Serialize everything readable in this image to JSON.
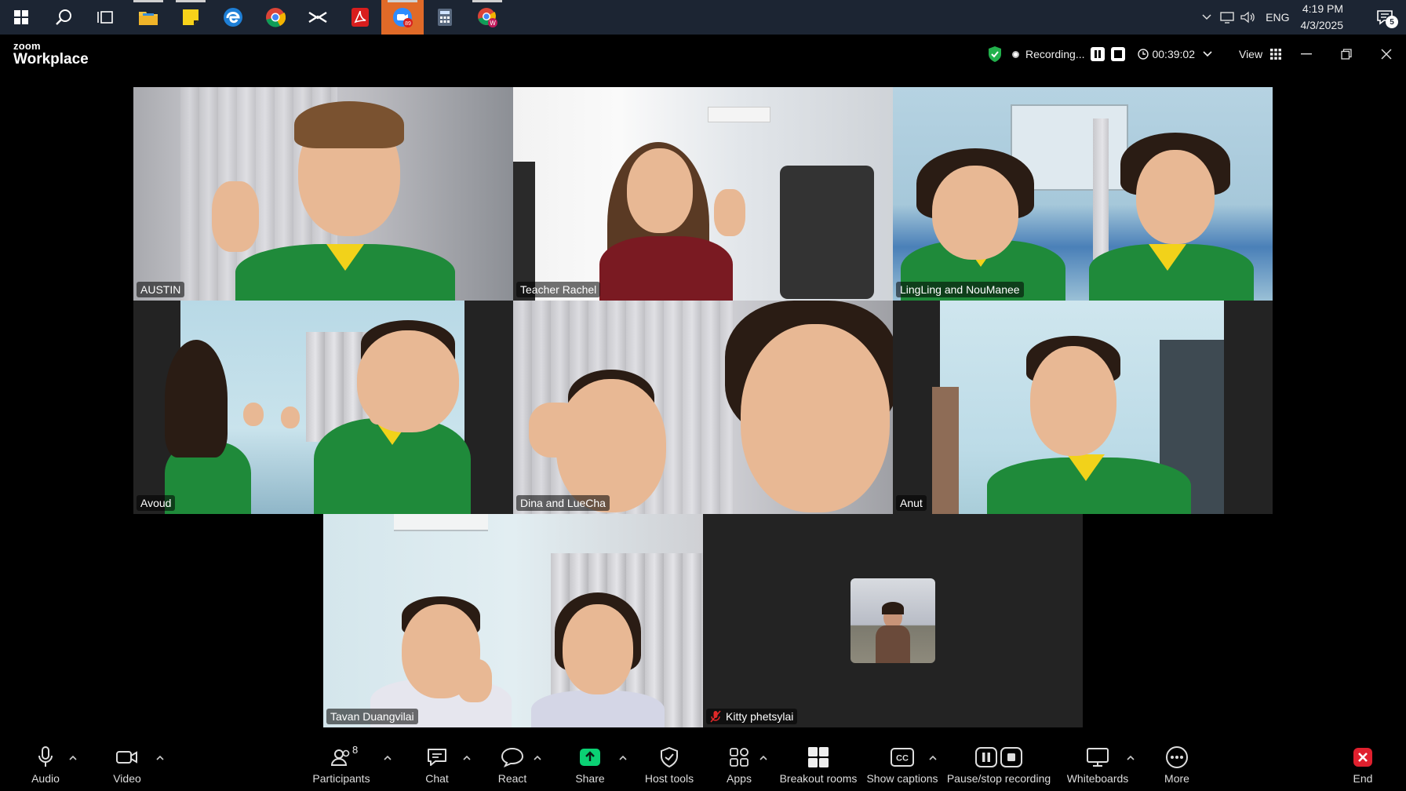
{
  "taskbar": {
    "apps": [
      {
        "name": "start-icon"
      },
      {
        "name": "search-icon"
      },
      {
        "name": "task-view-icon"
      },
      {
        "name": "file-explorer-icon"
      },
      {
        "name": "sticky-notes-icon"
      },
      {
        "name": "edge-icon"
      },
      {
        "name": "chrome-icon"
      },
      {
        "name": "capcut-icon"
      },
      {
        "name": "acrobat-icon"
      },
      {
        "name": "zoom-icon"
      },
      {
        "name": "calculator-icon"
      },
      {
        "name": "chrome-profile-icon"
      }
    ],
    "lang": "ENG",
    "time": "4:19 PM",
    "date": "4/3/2025",
    "notification_count": "5"
  },
  "zoom": {
    "logo_small": "zoom",
    "logo_big": "Workplace",
    "recording_label": "Recording...",
    "timer": "00:39:02",
    "view_label": "View"
  },
  "participants": [
    {
      "name": "AUSTIN"
    },
    {
      "name": "Teacher Rachel"
    },
    {
      "name": "LingLing and NouManee"
    },
    {
      "name": "Avoud"
    },
    {
      "name": "Dina and LueCha"
    },
    {
      "name": "Anut"
    },
    {
      "name": "Tavan Duangvilai"
    },
    {
      "name": "Kitty phetsylai"
    }
  ],
  "toolbar": {
    "audio": "Audio",
    "video": "Video",
    "participants": "Participants",
    "participants_count": "8",
    "chat": "Chat",
    "react": "React",
    "share": "Share",
    "host_tools": "Host tools",
    "apps": "Apps",
    "breakout_rooms": "Breakout rooms",
    "show_captions": "Show captions",
    "pause_stop_recording": "Pause/stop recording",
    "whiteboards": "Whiteboards",
    "more": "More",
    "end": "End"
  },
  "colors": {
    "speaker_outline": "#22d18b",
    "share_green": "#0bd174",
    "end_red": "#e0202e",
    "taskbar_bg": "#1c2533"
  }
}
